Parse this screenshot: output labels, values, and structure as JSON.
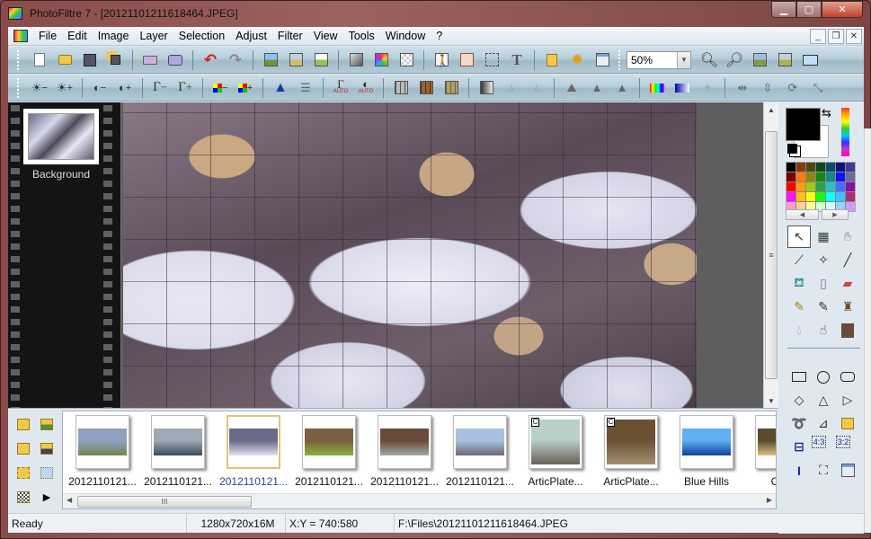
{
  "window": {
    "title": "PhotoFiltre 7 - [20121101211618464.JPEG]",
    "controls": {
      "minimize": "▁",
      "maximize": "▢",
      "close": "✕"
    }
  },
  "menubar": {
    "items": [
      "File",
      "Edit",
      "Image",
      "Layer",
      "Selection",
      "Adjust",
      "Filter",
      "View",
      "Tools",
      "Window",
      "?"
    ],
    "mdi_controls": {
      "minimize": "_",
      "restore": "❐",
      "close": "✕"
    }
  },
  "toolbar1": {
    "buttons": [
      "new-icon",
      "open-icon",
      "save-icon",
      "save-as-icon",
      "print-icon",
      "scan-icon",
      "undo-icon",
      "redo-icon",
      "paste-new-icon",
      "paste-icon",
      "duplicate-icon",
      "grayscale-icon",
      "color-palette-icon",
      "transparency-icon",
      "layer-icon",
      "layer-options-icon",
      "selection-icon",
      "text-icon",
      "explorer-icon",
      "plugin-icon",
      "module-icon"
    ],
    "zoom": {
      "value": "50%"
    },
    "right_buttons": [
      "zoom-in-icon",
      "zoom-out-icon",
      "fit-window-icon",
      "actual-size-icon",
      "fullscreen-icon"
    ]
  },
  "toolbar2": {
    "buttons": [
      "brightness-minus-icon",
      "brightness-plus-icon",
      "contrast-minus-icon",
      "contrast-plus-icon",
      "gamma-minus-icon",
      "gamma-plus-icon",
      "saturation-minus-icon",
      "saturation-plus-icon",
      "histogram-icon",
      "levels-icon",
      "auto-gamma-icon",
      "auto-contrast-icon",
      "texture1-icon",
      "texture2-icon",
      "texture3-icon",
      "fade-icon",
      "blur-icon",
      "blur-more-icon",
      "emboss-icon",
      "sharpen-icon",
      "sharpen-more-icon",
      "gradient-icon",
      "gradient2-icon",
      "transparency-mask-icon",
      "flip-h-icon",
      "flip-v-icon",
      "rotate-icon",
      "transform-icon"
    ],
    "auto_label": "AUTO"
  },
  "layers": {
    "items": [
      {
        "label": "Background"
      }
    ]
  },
  "colors": {
    "foreground": "#000000",
    "background": "#ffffff",
    "palette": [
      "#000000",
      "#8b3a10",
      "#4a4a10",
      "#0e4a16",
      "#104a6a",
      "#101080",
      "#3a3a9a",
      "#7a0000",
      "#ff7a10",
      "#8a8a10",
      "#108a10",
      "#108a8a",
      "#1010ff",
      "#6a6a9a",
      "#ff0000",
      "#ff9a10",
      "#9acc10",
      "#30a050",
      "#30c0c0",
      "#4070ff",
      "#8a10a0",
      "#ff10ff",
      "#ffc010",
      "#ffff10",
      "#10ff10",
      "#10ffff",
      "#40c0ff",
      "#aa3070",
      "#ff9ad0",
      "#ffd09a",
      "#ffff9a",
      "#d0ffd0",
      "#d0ffff",
      "#9ad0ff",
      "#d09aff"
    ]
  },
  "tools": {
    "group1": [
      "select-icon",
      "picker-window-icon",
      "hand-icon",
      "eyedropper-icon",
      "magic-wand-icon",
      "line-icon",
      "fill-bucket-icon",
      "spray-icon",
      "eraser-icon",
      "brush-icon",
      "advanced-brush-icon",
      "clone-stamp-icon",
      "blur-drop-icon",
      "smudge-icon",
      "pattern-icon"
    ],
    "group2": [
      "rectangle-icon",
      "ellipse-icon",
      "rounded-rect-icon",
      "diamond-icon",
      "triangle-icon",
      "arrow-icon",
      "lasso-icon",
      "polygon-icon",
      "folder-shape-icon",
      "selection-fixed-icon",
      "ratio-43-icon",
      "ratio-32-icon",
      "text-select-icon",
      "crop-handles-icon",
      "options-icon"
    ],
    "selected": "select-icon"
  },
  "explorer": {
    "side_buttons": [
      "folder-tree-icon",
      "folder-image-icon",
      "folder-open-icon",
      "folder-save-icon",
      "folder-select-icon",
      "folder-select2-icon",
      "folder-grid-icon",
      "play-icon"
    ],
    "thumbnails": [
      {
        "label": "2012110121...",
        "colors": [
          "#8fa0c0",
          "#6a8a50"
        ],
        "selected": false,
        "badge": ""
      },
      {
        "label": "2012110121...",
        "colors": [
          "#a0a8b4",
          "#3a4a5a"
        ],
        "selected": false,
        "badge": ""
      },
      {
        "label": "2012110121...",
        "colors": [
          "#6a6a8a",
          "#e0e0ee"
        ],
        "selected": true,
        "badge": ""
      },
      {
        "label": "2012110121...",
        "colors": [
          "#7a6040",
          "#8ab040"
        ],
        "selected": false,
        "badge": ""
      },
      {
        "label": "2012110121...",
        "colors": [
          "#6a4a3a",
          "#a0a8a0"
        ],
        "selected": false,
        "badge": ""
      },
      {
        "label": "2012110121...",
        "colors": [
          "#a8c0e0",
          "#6a6a70"
        ],
        "selected": false,
        "badge": ""
      },
      {
        "label": "ArticPlate...",
        "colors": [
          "#b8d0c8",
          "#6a6058"
        ],
        "selected": false,
        "badge": "C"
      },
      {
        "label": "ArticPlate...",
        "colors": [
          "#6a5030",
          "#a09070"
        ],
        "selected": false,
        "badge": "C"
      },
      {
        "label": "Blue Hills",
        "colors": [
          "#60b0f0",
          "#1040a0"
        ],
        "selected": false,
        "badge": ""
      },
      {
        "label": "Clou",
        "colors": [
          "#5a4a30",
          "#e0c080"
        ],
        "selected": false,
        "badge": ""
      }
    ],
    "scroll_grip": "III"
  },
  "statusbar": {
    "status": "Ready",
    "image_info": "1280x720x16M",
    "coords": "X:Y = 740:580",
    "path": "F:\\Files\\20121101211618464.JPEG"
  }
}
